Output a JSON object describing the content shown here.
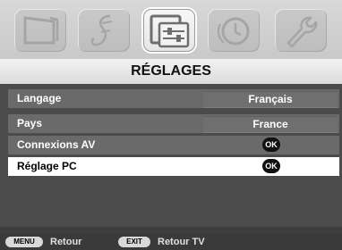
{
  "tabs": [
    {
      "icon": "picture-icon",
      "active": false
    },
    {
      "icon": "music-note-icon",
      "active": false
    },
    {
      "icon": "settings-sliders-icon",
      "active": true
    },
    {
      "icon": "clock-icon",
      "active": false
    },
    {
      "icon": "wrench-icon",
      "active": false
    }
  ],
  "header": {
    "title": "RÉGLAGES"
  },
  "menu": {
    "items": [
      {
        "label": "Langage",
        "value": "Français"
      },
      {
        "label": "Pays",
        "value": "France"
      },
      {
        "label": "Connexions AV",
        "ok": "OK"
      },
      {
        "label": "Réglage PC",
        "ok": "OK"
      }
    ]
  },
  "footer": {
    "menu_key": "MENU",
    "menu_label": "Retour",
    "exit_key": "EXIT",
    "exit_label": "Retour TV"
  },
  "colors": {
    "background": "#3e3e3e",
    "row": "#6a6a6a",
    "selected_row": "#ffffff"
  }
}
